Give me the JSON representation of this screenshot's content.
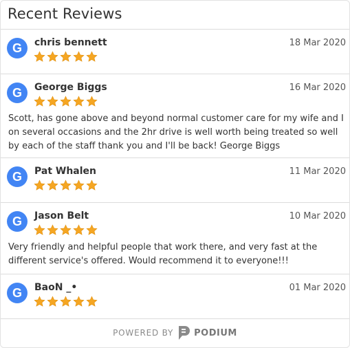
{
  "header": {
    "title": "Recent Reviews"
  },
  "reviews": [
    {
      "source_icon": "G",
      "name": "chris bennett",
      "date": "18 Mar 2020",
      "rating": 5,
      "text": ""
    },
    {
      "source_icon": "G",
      "name": "George Biggs",
      "date": "16 Mar 2020",
      "rating": 5,
      "text": "Scott, has gone above and beyond normal customer care for my wife and I on several occasions and the 2hr drive is well worth being treated so well by each of the staff thank you and I'll be back! George Biggs"
    },
    {
      "source_icon": "G",
      "name": "Pat Whalen",
      "date": "11 Mar 2020",
      "rating": 5,
      "text": ""
    },
    {
      "source_icon": "G",
      "name": "Jason Belt",
      "date": "10 Mar 2020",
      "rating": 5,
      "text": "Very friendly and helpful people that work there, and very fast at the different service's offered. Would recommend it to everyone!!!"
    },
    {
      "source_icon": "G",
      "name": "BaoN _•",
      "date": "01 Mar 2020",
      "rating": 5,
      "text": ""
    }
  ],
  "footer": {
    "powered_by": "POWERED BY",
    "brand": "PODIUM"
  },
  "colors": {
    "google_blue": "#4285f4",
    "star": "#f5a623",
    "divider": "#dcdcdc"
  },
  "icons": {
    "review_source": "google-g-icon",
    "rating": "star-icon",
    "brand": "podium-logo-icon"
  }
}
